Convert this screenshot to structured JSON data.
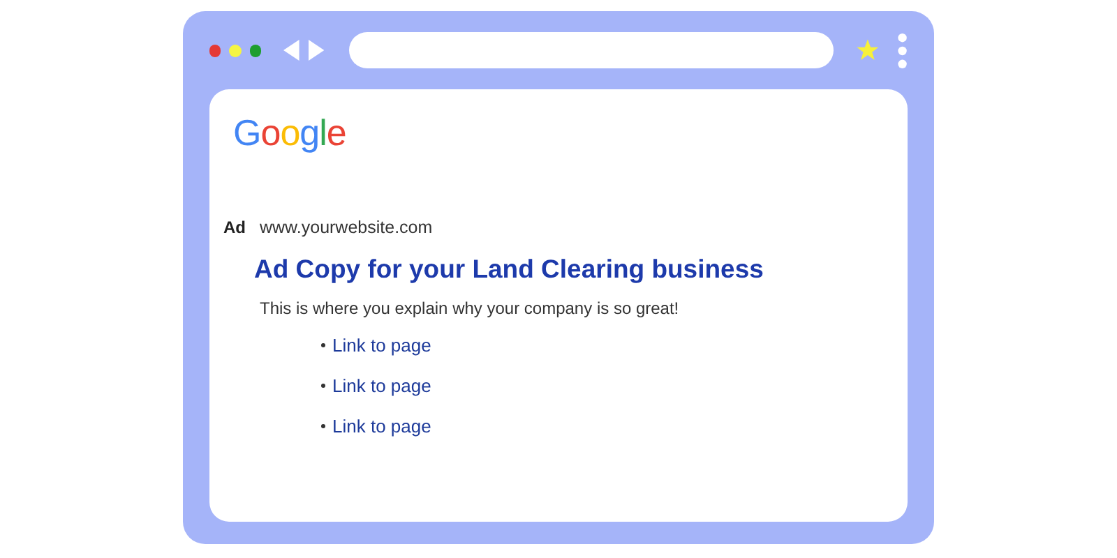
{
  "logo": "Google",
  "ad": {
    "badge": "Ad",
    "url": "www.yourwebsite.com",
    "title": "Ad Copy for your Land Clearing business",
    "description": "This is where you explain why your company is so great!",
    "links": [
      "Link to page",
      "Link to page",
      "Link to page"
    ]
  }
}
